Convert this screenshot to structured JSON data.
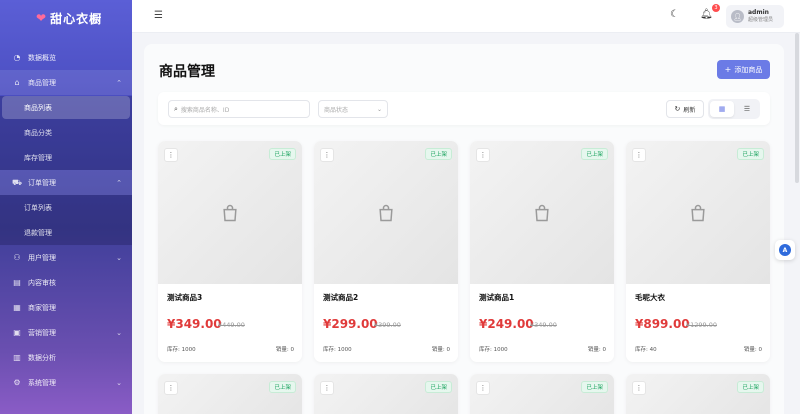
{
  "app": {
    "title": "甜心衣橱"
  },
  "sidebar": {
    "items": [
      {
        "label": "数据概览",
        "icon": "dashboard-icon"
      },
      {
        "label": "商品管理",
        "icon": "shop-icon",
        "expanded": true,
        "children": [
          {
            "label": "商品列表",
            "active": true
          },
          {
            "label": "商品分类"
          },
          {
            "label": "库存管理"
          }
        ]
      },
      {
        "label": "订单管理",
        "icon": "cart-icon",
        "expanded": true,
        "children": [
          {
            "label": "订单列表"
          },
          {
            "label": "退款管理"
          }
        ]
      },
      {
        "label": "用户管理",
        "icon": "user-icon"
      },
      {
        "label": "内容审核",
        "icon": "document-icon"
      },
      {
        "label": "商家管理",
        "icon": "store-icon"
      },
      {
        "label": "营销管理",
        "icon": "gift-icon"
      },
      {
        "label": "数据分析",
        "icon": "chart-icon"
      },
      {
        "label": "系统管理",
        "icon": "gear-icon"
      }
    ]
  },
  "header": {
    "notifications": "3",
    "user": {
      "name": "admin",
      "role": "超级管理员"
    }
  },
  "main": {
    "title": "商品管理",
    "add_button": "添加商品",
    "search_placeholder": "搜索商品名称、ID",
    "status_placeholder": "商品状态",
    "refresh_label": "刷新"
  },
  "products": [
    {
      "name": "测试商品3",
      "price": "¥349.00",
      "original_price": "¥449.00",
      "stock": "库存: 1000",
      "sales": "销量: 0",
      "status": "已上架"
    },
    {
      "name": "测试商品2",
      "price": "¥299.00",
      "original_price": "¥399.00",
      "stock": "库存: 1000",
      "sales": "销量: 0",
      "status": "已上架"
    },
    {
      "name": "测试商品1",
      "price": "¥249.00",
      "original_price": "¥349.00",
      "stock": "库存: 1000",
      "sales": "销量: 0",
      "status": "已上架"
    },
    {
      "name": "毛呢大衣",
      "price": "¥899.00",
      "original_price": "¥1299.00",
      "stock": "库存: 40",
      "sales": "销量: 0",
      "status": "已上架"
    }
  ],
  "products_row2": [
    {
      "status": "已上架"
    },
    {
      "status": "已上架"
    },
    {
      "status": "已上架"
    },
    {
      "status": "已上架"
    }
  ],
  "colors": {
    "accent": "#6b7be6",
    "price": "#e03a3a",
    "status_green": "#14a05a"
  }
}
